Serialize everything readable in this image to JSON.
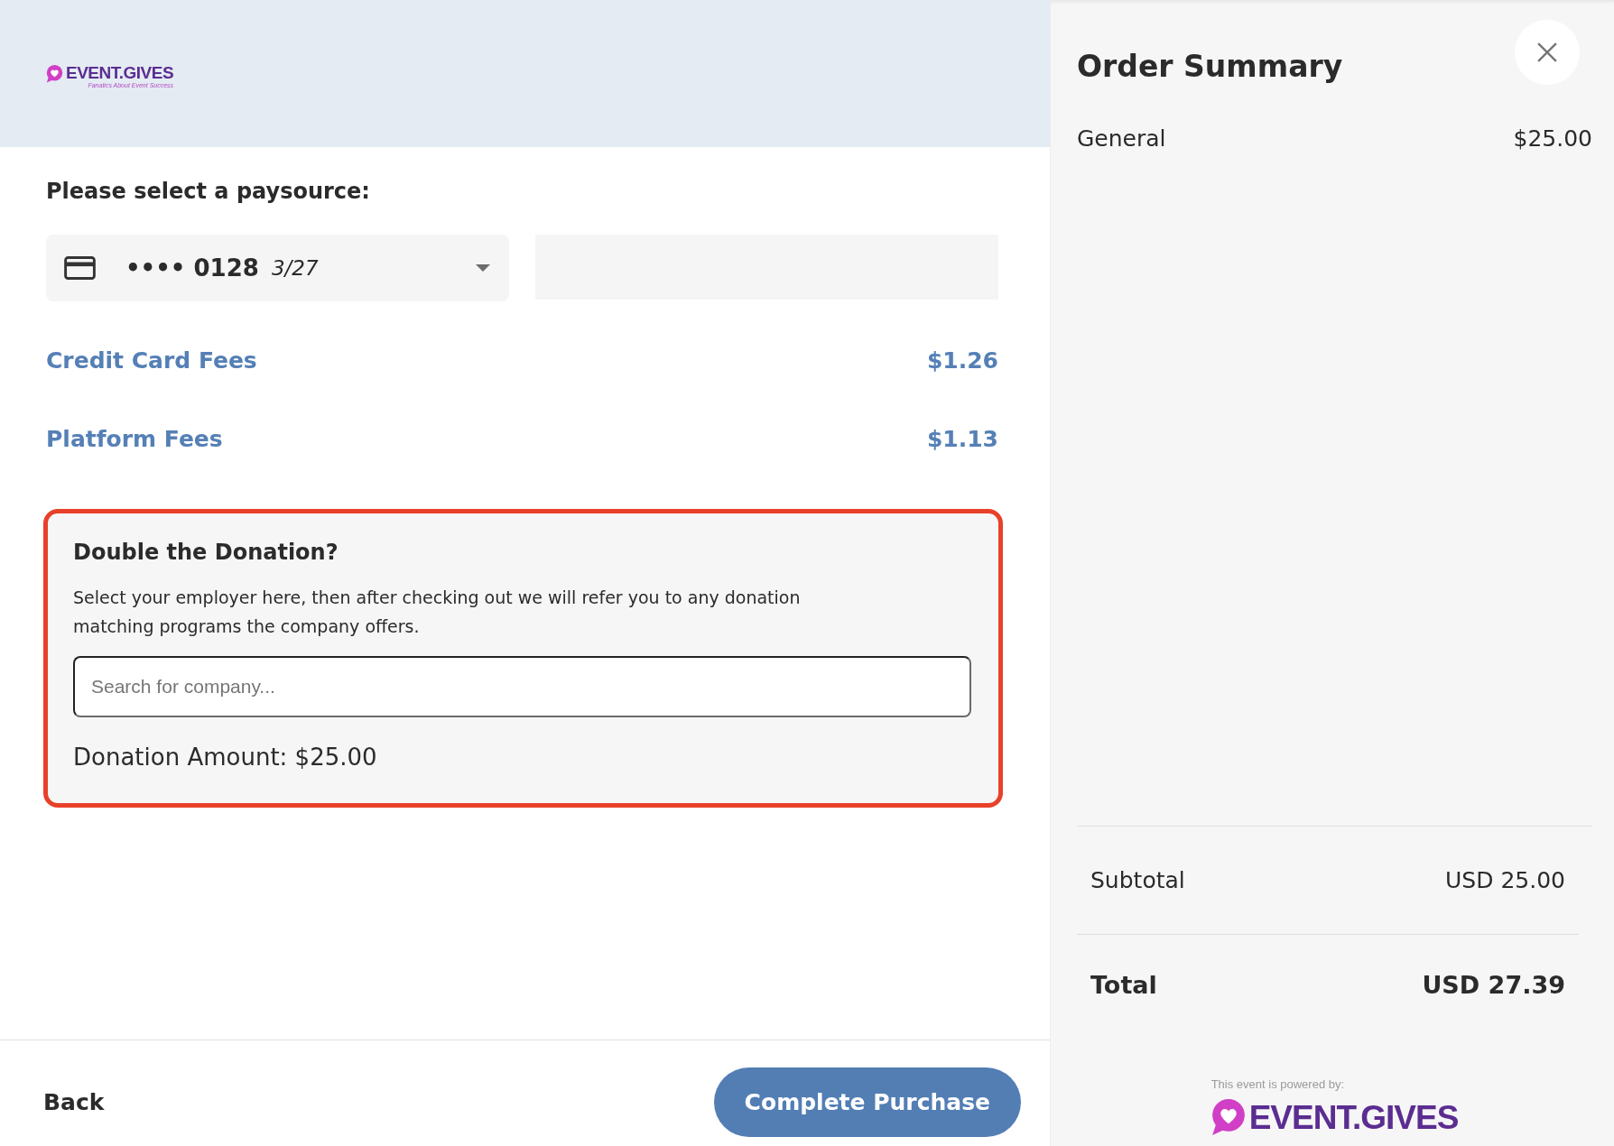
{
  "header": {
    "logo": {
      "wordmark": "EVENT.GIVES",
      "tagline": "Fanatics About Event Success"
    }
  },
  "paysource": {
    "label": "Please select a paysource:",
    "card": {
      "masked_number": "•••• 0128",
      "expiry": "3/27"
    }
  },
  "fees": [
    {
      "label": "Credit Card Fees",
      "amount": "$1.26"
    },
    {
      "label": "Platform Fees",
      "amount": "$1.13"
    }
  ],
  "donation_match": {
    "title": "Double the Donation?",
    "description": "Select your employer here, then after checking out we will refer you to any donation matching programs the company offers.",
    "search": {
      "placeholder": "Search for company..."
    },
    "amount": "Donation Amount: $25.00"
  },
  "footer": {
    "back": "Back",
    "submit": "Complete Purchase"
  },
  "order_summary": {
    "title": "Order Summary",
    "items": [
      {
        "name": "General",
        "price": "$25.00"
      }
    ],
    "subtotal": {
      "label": "Subtotal",
      "value": "USD 25.00"
    },
    "total": {
      "label": "Total",
      "value": "USD 27.39"
    },
    "powered_by": "This event is powered by:",
    "logo": {
      "wordmark": "EVENT.GIVES"
    }
  }
}
